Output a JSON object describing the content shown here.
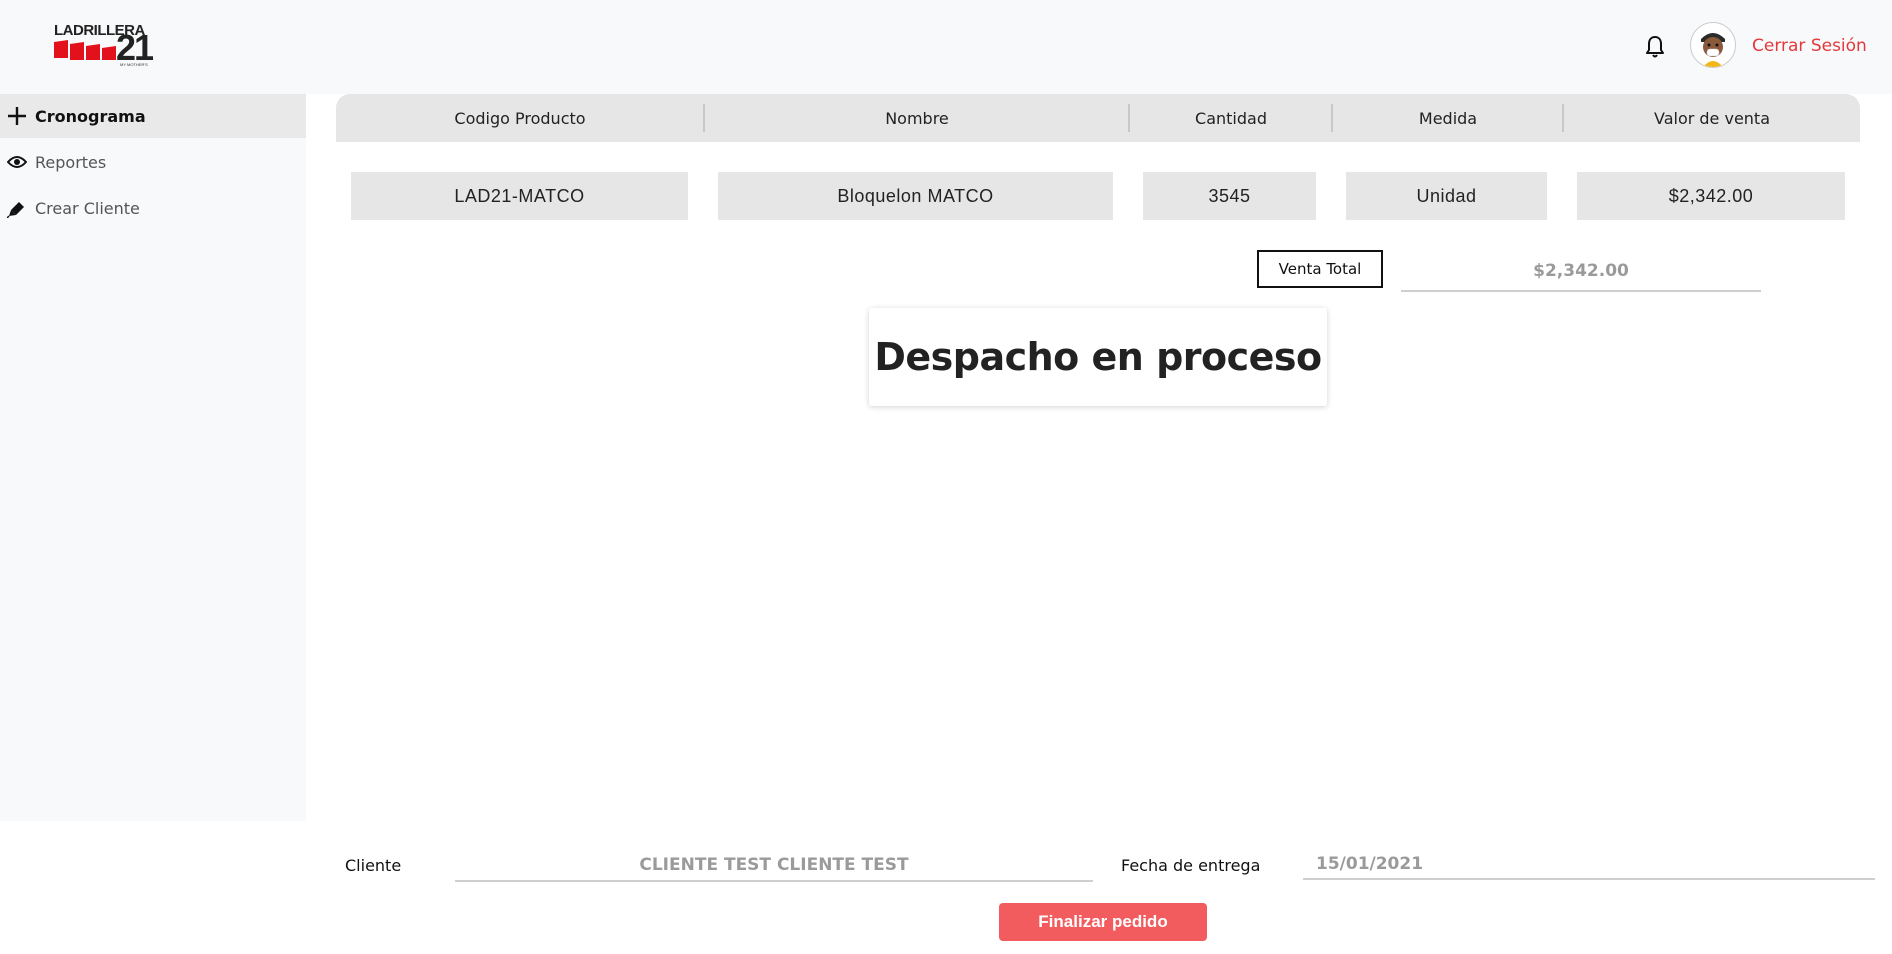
{
  "header": {
    "logo": {
      "brand": "LADRILLERA",
      "number": "21",
      "tagline": "MY MOTHER'S"
    },
    "logout_label": "Cerrar Sesión",
    "accent_color": "#e5383b"
  },
  "sidebar": {
    "items": [
      {
        "label": "Cronograma",
        "icon": "plus-icon",
        "active": true
      },
      {
        "label": "Reportes",
        "icon": "eye-icon",
        "active": false
      },
      {
        "label": "Crear Cliente",
        "icon": "pencil-icon",
        "active": false
      }
    ]
  },
  "table": {
    "columns": [
      "Codigo Producto",
      "Nombre",
      "Cantidad",
      "Medida",
      "Valor de venta"
    ],
    "rows": [
      [
        "LAD21-MATCO",
        "Bloquelon MATCO",
        "3545",
        "Unidad",
        "$2,342.00"
      ]
    ]
  },
  "total": {
    "label": "Venta Total",
    "value": "$2,342.00"
  },
  "status": {
    "text": "Despacho en proceso"
  },
  "form": {
    "cliente_label": "Cliente",
    "cliente_value": "CLIENTE TEST CLIENTE TEST",
    "fecha_label": "Fecha de entrega",
    "fecha_value": "15/01/2021",
    "finalize_label": "Finalizar pedido",
    "finalize_color": "#f25c5f"
  }
}
